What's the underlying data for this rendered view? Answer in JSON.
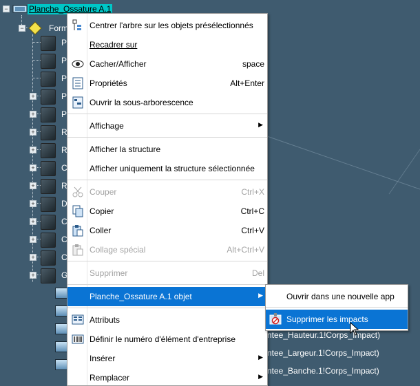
{
  "tree": {
    "root_label": "Planche_Ossature A.1",
    "child_label": "Form",
    "row_letters": [
      "P",
      "P",
      "P",
      "P",
      "P",
      "R",
      "R",
      "C",
      "R",
      "D",
      "C",
      "C",
      "C",
      "G"
    ],
    "background_texts": [
      "ntee_Hauteur.1!Corps_Impact)",
      "ntee_Largeur.1!Corps_Impact)",
      "ntee_Banche.1!Corps_Impact)"
    ]
  },
  "menu": {
    "items": [
      {
        "label": "Centrer l'arbre sur les objets présélectionnés",
        "shortcut": "",
        "icon": "center-tree-icon"
      },
      {
        "label": "Recadrer sur",
        "shortcut": "",
        "icon": ""
      },
      {
        "label": "Cacher/Afficher",
        "shortcut": "space",
        "icon": "eye-icon"
      },
      {
        "label": "Propriétés",
        "shortcut": "Alt+Enter",
        "icon": "properties-icon"
      },
      {
        "label": "Ouvrir la sous-arborescence",
        "shortcut": "",
        "icon": "open-subtree-icon"
      },
      {
        "label": "Affichage",
        "shortcut": "",
        "icon": ""
      },
      {
        "label": "Afficher la structure",
        "shortcut": "",
        "icon": ""
      },
      {
        "label": "Afficher uniquement la structure sélectionnée",
        "shortcut": "",
        "icon": ""
      },
      {
        "label": "Couper",
        "shortcut": "Ctrl+X",
        "icon": "scissors-icon"
      },
      {
        "label": "Copier",
        "shortcut": "Ctrl+C",
        "icon": "copy-icon"
      },
      {
        "label": "Coller",
        "shortcut": "Ctrl+V",
        "icon": "paste-icon"
      },
      {
        "label": "Collage spécial",
        "shortcut": "Alt+Ctrl+V",
        "icon": "paste-special-icon"
      },
      {
        "label": "Supprimer",
        "shortcut": "Del",
        "icon": ""
      },
      {
        "label": "Planche_Ossature A.1 objet",
        "shortcut": "",
        "icon": ""
      },
      {
        "label": "Attributs",
        "shortcut": "",
        "icon": "attributes-icon"
      },
      {
        "label": "Définir le numéro d'élément d'entreprise",
        "shortcut": "",
        "icon": "barcode-icon"
      },
      {
        "label": "Insérer",
        "shortcut": "",
        "icon": ""
      },
      {
        "label": "Remplacer",
        "shortcut": "",
        "icon": ""
      }
    ]
  },
  "submenu": {
    "items": [
      {
        "label": "Ouvrir dans une nouvelle app"
      },
      {
        "label": "Supprimer les impacts"
      }
    ]
  },
  "colors": {
    "background": "#3f5b6f",
    "selection": "#0a74d4",
    "root_highlight": "#00c7c7"
  }
}
